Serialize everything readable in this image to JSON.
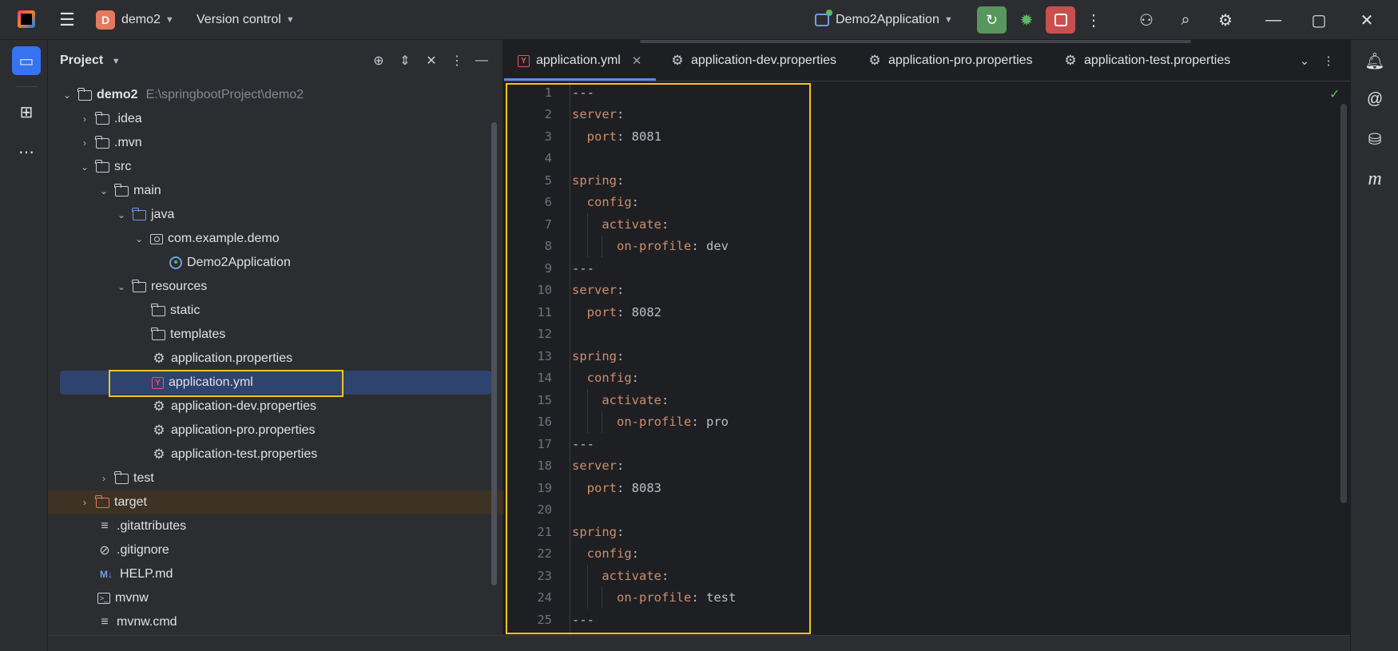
{
  "titlebar": {
    "project_initial": "D",
    "project_name": "demo2",
    "version_control": "Version control",
    "run_config": "Demo2Application"
  },
  "project_panel": {
    "title": "Project",
    "tree": [
      {
        "label": "demo2",
        "path": "E:\\springbootProject\\demo2"
      },
      {
        "label": ".idea"
      },
      {
        "label": ".mvn"
      },
      {
        "label": "src"
      },
      {
        "label": "main"
      },
      {
        "label": "java"
      },
      {
        "label": "com.example.demo"
      },
      {
        "label": "Demo2Application"
      },
      {
        "label": "resources"
      },
      {
        "label": "static"
      },
      {
        "label": "templates"
      },
      {
        "label": "application.properties"
      },
      {
        "label": "application.yml"
      },
      {
        "label": "application-dev.properties"
      },
      {
        "label": "application-pro.properties"
      },
      {
        "label": "application-test.properties"
      },
      {
        "label": "test"
      },
      {
        "label": "target"
      },
      {
        "label": ".gitattributes"
      },
      {
        "label": ".gitignore"
      },
      {
        "label": "HELP.md"
      },
      {
        "label": "mvnw"
      },
      {
        "label": "mvnw.cmd"
      }
    ]
  },
  "editor": {
    "tabs": [
      {
        "label": "application.yml"
      },
      {
        "label": "application-dev.properties"
      },
      {
        "label": "application-pro.properties"
      },
      {
        "label": "application-test.properties"
      }
    ],
    "lines": [
      {
        "n": "1",
        "key": "---",
        "sep": "",
        "val": ""
      },
      {
        "n": "2",
        "key": "server",
        "sep": ":",
        "val": ""
      },
      {
        "n": "3",
        "key": "  port",
        "sep": ":",
        "val": " 8081"
      },
      {
        "n": "4",
        "key": "",
        "sep": "",
        "val": ""
      },
      {
        "n": "5",
        "key": "spring",
        "sep": ":",
        "val": ""
      },
      {
        "n": "6",
        "key": "  config",
        "sep": ":",
        "val": ""
      },
      {
        "n": "7",
        "key": "    activate",
        "sep": ":",
        "val": ""
      },
      {
        "n": "8",
        "key": "      on-profile",
        "sep": ":",
        "val": " dev"
      },
      {
        "n": "9",
        "key": "---",
        "sep": "",
        "val": ""
      },
      {
        "n": "10",
        "key": "server",
        "sep": ":",
        "val": ""
      },
      {
        "n": "11",
        "key": "  port",
        "sep": ":",
        "val": " 8082"
      },
      {
        "n": "12",
        "key": "",
        "sep": "",
        "val": ""
      },
      {
        "n": "13",
        "key": "spring",
        "sep": ":",
        "val": ""
      },
      {
        "n": "14",
        "key": "  config",
        "sep": ":",
        "val": ""
      },
      {
        "n": "15",
        "key": "    activate",
        "sep": ":",
        "val": ""
      },
      {
        "n": "16",
        "key": "      on-profile",
        "sep": ":",
        "val": " pro"
      },
      {
        "n": "17",
        "key": "---",
        "sep": "",
        "val": ""
      },
      {
        "n": "18",
        "key": "server",
        "sep": ":",
        "val": ""
      },
      {
        "n": "19",
        "key": "  port",
        "sep": ":",
        "val": " 8083"
      },
      {
        "n": "20",
        "key": "",
        "sep": "",
        "val": ""
      },
      {
        "n": "21",
        "key": "spring",
        "sep": ":",
        "val": ""
      },
      {
        "n": "22",
        "key": "  config",
        "sep": ":",
        "val": ""
      },
      {
        "n": "23",
        "key": "    activate",
        "sep": ":",
        "val": ""
      },
      {
        "n": "24",
        "key": "      on-profile",
        "sep": ":",
        "val": " test"
      },
      {
        "n": "25",
        "key": "---",
        "sep": "",
        "val": ""
      }
    ]
  },
  "colors": {
    "accent": "#3574f0",
    "highlight_box": "#f5c518",
    "yaml_key": "#cf8e6d",
    "run_green": "#57965c",
    "stop_red": "#c94f4f"
  }
}
